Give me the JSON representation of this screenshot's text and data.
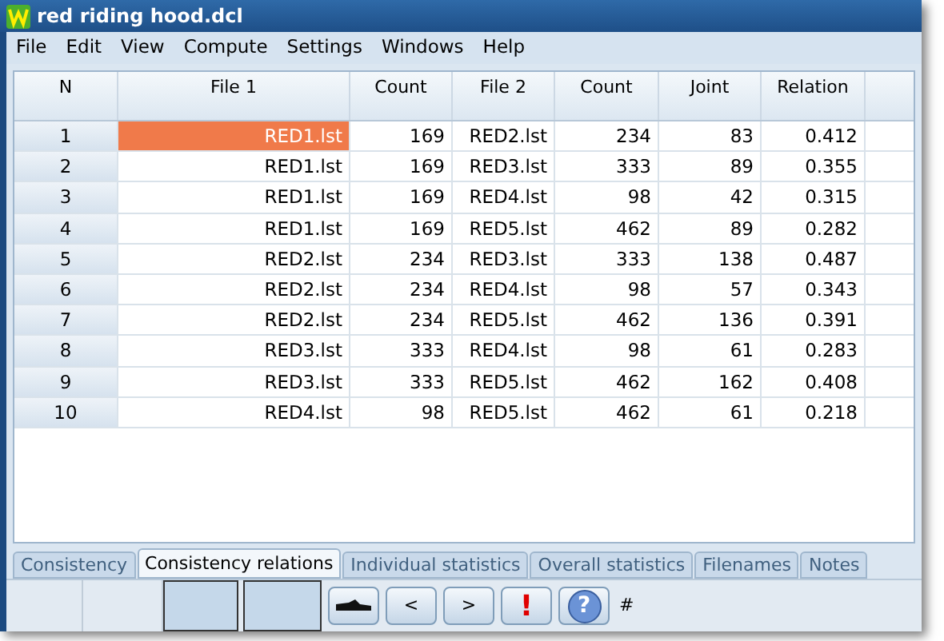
{
  "window": {
    "title": "red riding hood.dcl"
  },
  "menu": [
    "File",
    "Edit",
    "View",
    "Compute",
    "Settings",
    "Windows",
    "Help"
  ],
  "table": {
    "columns": [
      "N",
      "File 1",
      "Count",
      "File 2",
      "Count",
      "Joint",
      "Relation"
    ],
    "rows": [
      {
        "cells": [
          "1",
          "RED1.lst",
          "169",
          "RED2.lst",
          "234",
          "83",
          "0.412"
        ],
        "selected": [
          false,
          true,
          false,
          false,
          false,
          false,
          false
        ]
      },
      {
        "cells": [
          "2",
          "RED1.lst",
          "169",
          "RED3.lst",
          "333",
          "89",
          "0.355"
        ],
        "selected": [
          false,
          false,
          false,
          false,
          false,
          false,
          false
        ]
      },
      {
        "cells": [
          "3",
          "RED1.lst",
          "169",
          "RED4.lst",
          "98",
          "42",
          "0.315"
        ],
        "selected": [
          false,
          false,
          false,
          false,
          false,
          false,
          false
        ]
      },
      {
        "cells": [
          "4",
          "RED1.lst",
          "169",
          "RED5.lst",
          "462",
          "89",
          "0.282"
        ],
        "selected": [
          false,
          false,
          false,
          false,
          false,
          false,
          false
        ]
      },
      {
        "cells": [
          "5",
          "RED2.lst",
          "234",
          "RED3.lst",
          "333",
          "138",
          "0.487"
        ],
        "selected": [
          false,
          false,
          false,
          false,
          false,
          false,
          false
        ]
      },
      {
        "cells": [
          "6",
          "RED2.lst",
          "234",
          "RED4.lst",
          "98",
          "57",
          "0.343"
        ],
        "selected": [
          false,
          false,
          false,
          false,
          false,
          false,
          false
        ]
      },
      {
        "cells": [
          "7",
          "RED2.lst",
          "234",
          "RED5.lst",
          "462",
          "136",
          "0.391"
        ],
        "selected": [
          false,
          false,
          false,
          false,
          false,
          false,
          false
        ]
      },
      {
        "cells": [
          "8",
          "RED3.lst",
          "333",
          "RED4.lst",
          "98",
          "61",
          "0.283"
        ],
        "selected": [
          false,
          false,
          false,
          false,
          false,
          false,
          false
        ]
      },
      {
        "cells": [
          "9",
          "RED3.lst",
          "333",
          "RED5.lst",
          "462",
          "162",
          "0.408"
        ],
        "selected": [
          false,
          false,
          false,
          false,
          false,
          false,
          false
        ]
      },
      {
        "cells": [
          "10",
          "RED4.lst",
          "98",
          "RED5.lst",
          "462",
          "61",
          "0.218"
        ],
        "selected": [
          false,
          false,
          false,
          false,
          false,
          false,
          false
        ]
      }
    ]
  },
  "tabs": [
    {
      "label": "Consistency",
      "selected": false
    },
    {
      "label": "Consistency relations",
      "selected": true
    },
    {
      "label": "Individual statistics",
      "selected": false
    },
    {
      "label": "Overall statistics",
      "selected": false
    },
    {
      "label": "Filenames",
      "selected": false
    },
    {
      "label": "Notes",
      "selected": false
    }
  ],
  "toolbar": [
    {
      "kind": "hand"
    },
    {
      "kind": "text",
      "label": "<"
    },
    {
      "kind": "text",
      "label": ">"
    },
    {
      "kind": "alert",
      "label": "!"
    },
    {
      "kind": "help",
      "label": "?"
    }
  ],
  "status": "#"
}
